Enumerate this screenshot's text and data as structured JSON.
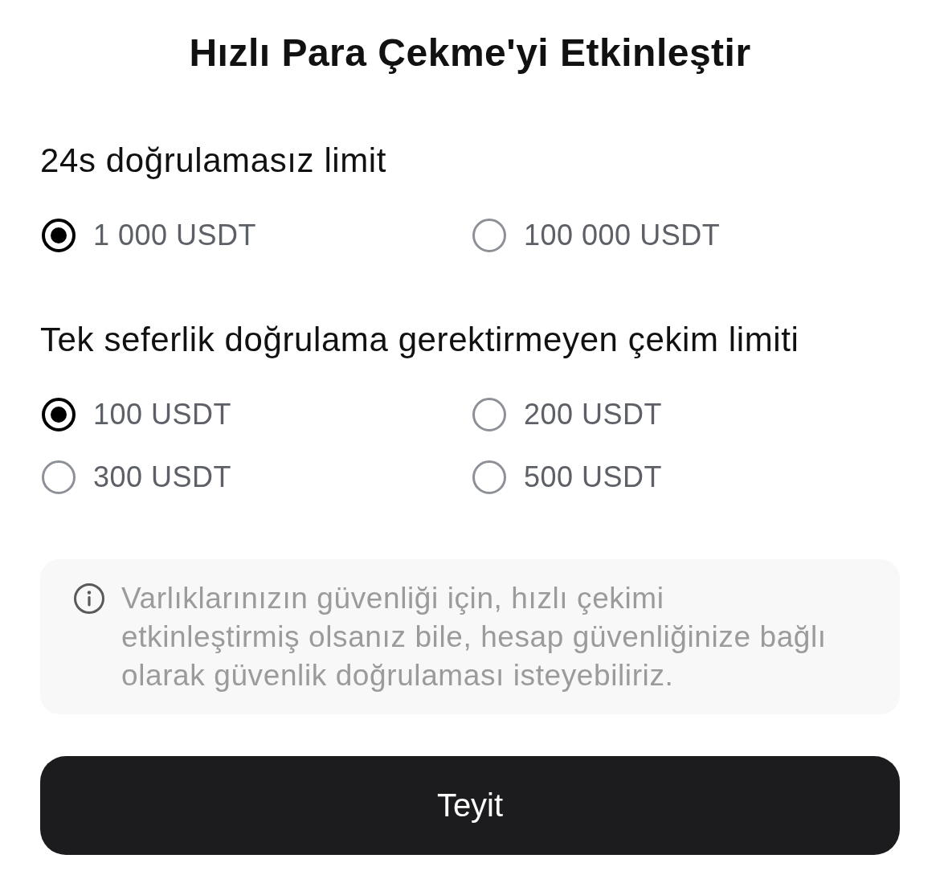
{
  "title": "Hızlı Para Çekme'yi Etkinleştir",
  "sections": [
    {
      "heading": "24s doğrulamasız limit",
      "options": [
        {
          "label": "1 000 USDT",
          "selected": true
        },
        {
          "label": "100 000 USDT",
          "selected": false
        }
      ]
    },
    {
      "heading": "Tek seferlik doğrulama gerektirmeyen çekim limiti",
      "options": [
        {
          "label": "100 USDT",
          "selected": true
        },
        {
          "label": "200 USDT",
          "selected": false
        },
        {
          "label": "300 USDT",
          "selected": false
        },
        {
          "label": "500 USDT",
          "selected": false
        }
      ]
    }
  ],
  "notice": {
    "text": "Varlıklarınızın güvenliği için, hızlı çekimi etkinleştirmiş olsanız bile, hesap güvenliğinize bağlı olarak güvenlik doğrulaması isteyebiliriz."
  },
  "confirm_button": {
    "label": "Teyit"
  }
}
